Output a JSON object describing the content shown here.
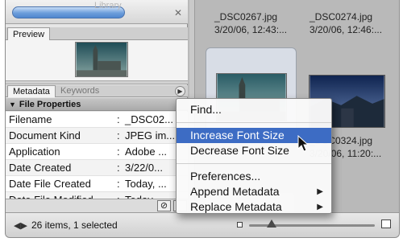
{
  "folder_strip": {
    "label": "Library"
  },
  "preview_tab": {
    "label": "Preview"
  },
  "tabs": [
    {
      "label": "Metadata"
    },
    {
      "label": "Keywords"
    }
  ],
  "section": {
    "title": "File Properties"
  },
  "metadata_rows": [
    {
      "key": "Filename",
      "sep": ":",
      "value": "_DSC02..."
    },
    {
      "key": "Document Kind",
      "sep": ":",
      "value": "JPEG im..."
    },
    {
      "key": "Application",
      "sep": ":",
      "value": "Adobe ..."
    },
    {
      "key": "Date Created",
      "sep": ":",
      "value": "3/22/0..."
    },
    {
      "key": "Date File Created",
      "sep": ":",
      "value": "Today, ..."
    },
    {
      "key": "Date File Modified",
      "sep": ":",
      "value": "Today, ..."
    }
  ],
  "thumbnails": [
    {
      "name": "_DSC0267.jpg",
      "date": "3/20/06, 12:43:..."
    },
    {
      "name": "_DSC0274.jpg",
      "date": "3/20/06, 12:46:..."
    },
    {
      "name": "_DSC0324.jpg",
      "date": "3/20/06, 11:20:..."
    }
  ],
  "context_menu": {
    "items": [
      {
        "label": "Find..."
      },
      {
        "label": "Increase Font Size"
      },
      {
        "label": "Decrease Font Size"
      },
      {
        "label": "Preferences..."
      },
      {
        "label": "Append Metadata"
      },
      {
        "label": "Replace Metadata"
      }
    ],
    "highlighted_item": "Increase Font Size"
  },
  "status": {
    "text": "26 items, 1 selected"
  },
  "icons": {
    "pane_toggle": "left-right-arrows-icon",
    "panel_menu": "right-triangle-icon",
    "no_action": "prohibited-icon",
    "submenu": "submenu-arrow-icon",
    "cursor": "mouse-pointer-icon"
  },
  "colors": {
    "highlight": "#3d6cc4",
    "window_bg": "#b9b9b9"
  }
}
